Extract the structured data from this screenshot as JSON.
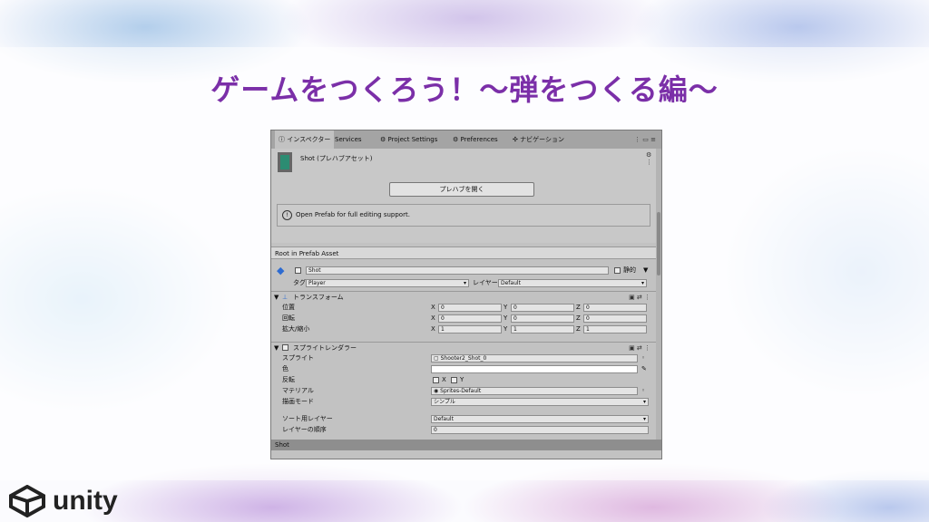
{
  "slide": {
    "title": "ゲームをつくろう！～弾をつくる編～",
    "logo_text": "unity"
  },
  "tabs": [
    "インスペクター",
    "Services",
    "Project Settings",
    "Preferences",
    "ナビゲーション"
  ],
  "header": {
    "asset_title": "Shot (プレハブアセット)",
    "open_button": "プレハブを開く",
    "info_text": "Open Prefab for full editing support.",
    "root_label": "Root in Prefab Asset"
  },
  "object": {
    "name": "Shot",
    "static_label": "静的",
    "tag_label": "タグ",
    "tag_value": "Player",
    "layer_label": "レイヤー",
    "layer_value": "Default"
  },
  "transform": {
    "title": "トランスフォーム",
    "rows": [
      {
        "label": "位置",
        "x": "0",
        "y": "0",
        "z": "0"
      },
      {
        "label": "回転",
        "x": "0",
        "y": "0",
        "z": "0"
      },
      {
        "label": "拡大/縮小",
        "x": "1",
        "y": "1",
        "z": "1"
      }
    ]
  },
  "sprite_renderer": {
    "title": "スプライトレンダラー",
    "sprite_label": "スプライト",
    "sprite_value": "Shooter2_Shot_0",
    "color_label": "色",
    "flip_label": "反転",
    "flip_x": "X",
    "flip_y": "Y",
    "material_label": "マテリアル",
    "material_value": "Sprites-Default",
    "draw_mode_label": "描画モード",
    "draw_mode_value": "シンプル",
    "sort_layer_label": "ソート用レイヤー",
    "sort_layer_value": "Default",
    "order_label": "レイヤーの順序",
    "order_value": "0"
  },
  "status": {
    "text": "Shot"
  }
}
